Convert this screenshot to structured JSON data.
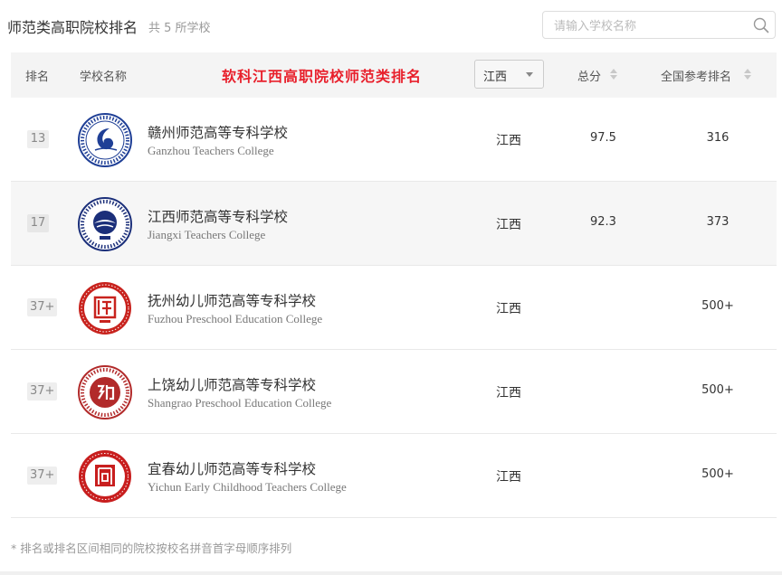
{
  "header": {
    "title": "师范类高职院校排名",
    "count_text": "共 5 所学校"
  },
  "search": {
    "placeholder": "请输入学校名称",
    "value": ""
  },
  "table": {
    "col_rank": "排名",
    "col_school": "学校名称",
    "banner": "软科江西高职院校师范类排名",
    "province_filter": "江西",
    "col_score": "总分",
    "col_national": "全国参考排名"
  },
  "rows": [
    {
      "rank": "13",
      "cn": "赣州师范高等专科学校",
      "en": "Ganzhou Teachers College",
      "province": "江西",
      "score": "97.5",
      "national": "316",
      "logo": "ganzhou-teachers-college-logo",
      "logo_color": "#1f3f96"
    },
    {
      "rank": "17",
      "cn": "江西师范高等专科学校",
      "en": "Jiangxi Teachers College",
      "province": "江西",
      "score": "92.3",
      "national": "373",
      "logo": "jiangxi-teachers-college-logo",
      "logo_color": "#1b2f7a"
    },
    {
      "rank": "37+",
      "cn": "抚州幼儿师范高等专科学校",
      "en": "Fuzhou Preschool Education College",
      "province": "江西",
      "score": "",
      "national": "500+",
      "logo": "fuzhou-preschool-college-logo",
      "logo_color": "#c8231e"
    },
    {
      "rank": "37+",
      "cn": "上饶幼儿师范高等专科学校",
      "en": "Shangrao Preschool Education College",
      "province": "江西",
      "score": "",
      "national": "500+",
      "logo": "shangrao-preschool-college-logo",
      "logo_color": "#b22a2a"
    },
    {
      "rank": "37+",
      "cn": "宜春幼儿师范高等专科学校",
      "en": "Yichun Early Childhood Teachers College",
      "province": "江西",
      "score": "",
      "national": "500+",
      "logo": "yichun-early-childhood-college-logo",
      "logo_color": "#c81e1e"
    }
  ],
  "footnote": "* 排名或排名区间相同的院校按校名拼音首字母顺序排列",
  "colors": {
    "banner": "#e8202c",
    "header_bg": "#f4f4f4",
    "alt_row_bg": "#f6f6f6"
  }
}
